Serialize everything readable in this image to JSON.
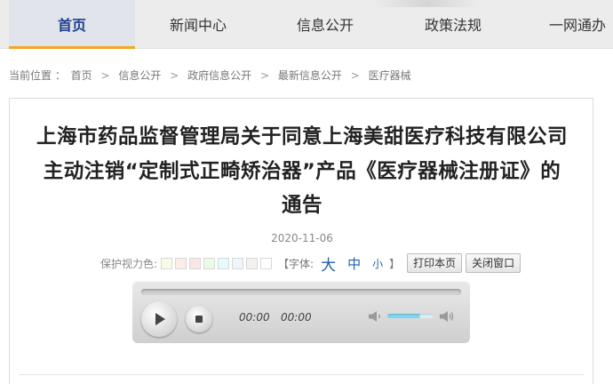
{
  "nav": {
    "items": [
      {
        "label": "首页",
        "active": true
      },
      {
        "label": "新闻中心",
        "active": false
      },
      {
        "label": "信息公开",
        "active": false
      },
      {
        "label": "政策法规",
        "active": false
      },
      {
        "label": "一网通办",
        "active": false
      }
    ],
    "accent_color": "#f5a623"
  },
  "breadcrumb": {
    "prefix": "当前位置 ：",
    "items": [
      "首页",
      "信息公开",
      "政府信息公开",
      "最新信息公开",
      "医疗器械"
    ],
    "separator": ">"
  },
  "article": {
    "title_lines": [
      "上海市药品监督管理局关于同意上海美甜医疗科技有限公司",
      "主动注销“定制式正畸矫治器”产品《医疗器械注册证》的",
      "通告"
    ],
    "date": "2020-11-06"
  },
  "tools": {
    "eye_care_label": "保护视力色:",
    "swatches": [
      "#fafae8",
      "#fbeee6",
      "#fbe6e6",
      "#eafbe6",
      "#e6fbfb",
      "#eef6fb",
      "#f2f2f2",
      "#ffffff"
    ],
    "font_label_open": "【字体:",
    "font_big": "大",
    "font_mid": "中",
    "font_small": "小",
    "font_label_close": "】",
    "print_button": "打印本页",
    "close_button": "关闭窗口"
  },
  "player": {
    "current_time": "00:00",
    "duration": "00:00",
    "progress": 0,
    "volume": 0.7,
    "volume_color": "#7fd4f0"
  }
}
